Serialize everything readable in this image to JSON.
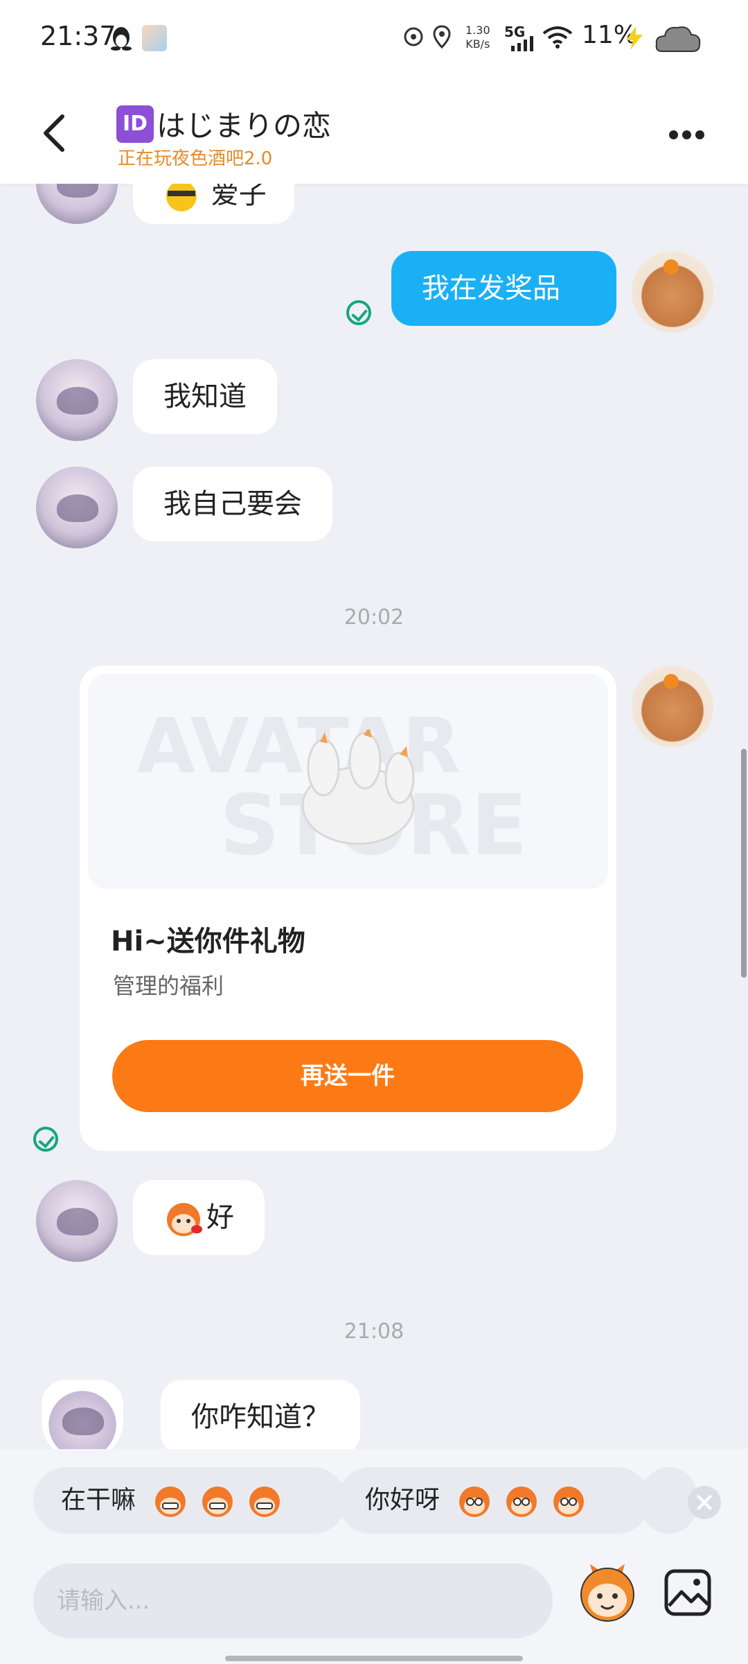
{
  "status_bar": {
    "time": "21:37",
    "net_speed_value": "1.30",
    "net_speed_unit": "KB/s",
    "network": "5G",
    "battery": "11%"
  },
  "header": {
    "id_badge": "ID",
    "title": "はじまりの恋",
    "subtitle": "正在玩夜色酒吧2.0"
  },
  "messages": {
    "top_partial": "爱子",
    "m1": "我在发奖品",
    "m2": "我知道",
    "m3": "我自己要会",
    "time1": "20:02",
    "gift": {
      "watermark_1": "AVATAR",
      "watermark_2": "STORE",
      "title": "Hi~送你件礼物",
      "subtitle": "管理的福利",
      "button": "再送一件"
    },
    "m4": "好",
    "time2": "21:08",
    "m5": "你咋知道？"
  },
  "quick_replies": [
    {
      "label": "在干嘛"
    },
    {
      "label": "你好呀"
    }
  ],
  "input": {
    "placeholder": "请输入..."
  },
  "colors": {
    "accent_blue": "#1ab0f5",
    "accent_orange": "#fb7a15",
    "check_green": "#16a77a",
    "subtitle_orange": "#e58a2a"
  }
}
